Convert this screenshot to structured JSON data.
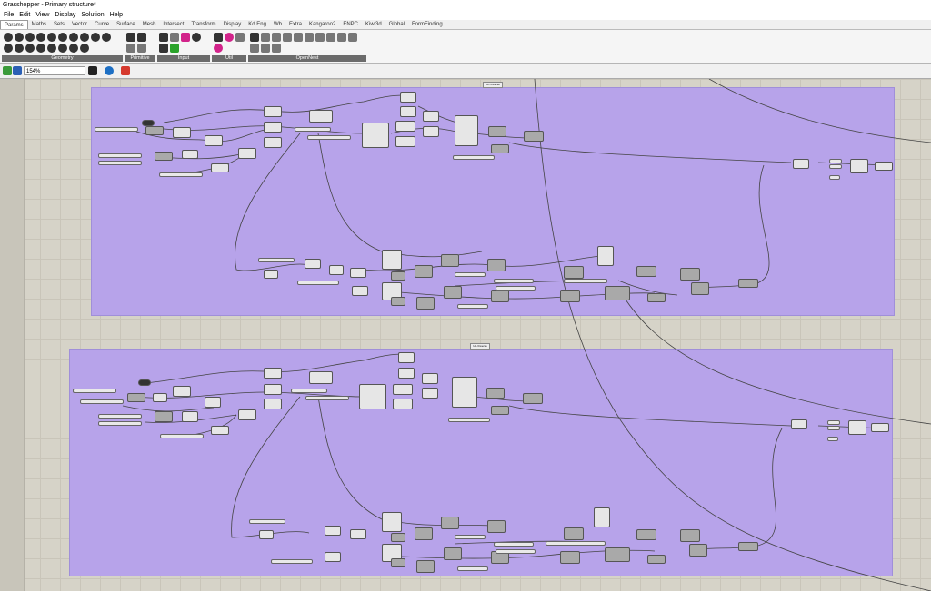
{
  "window": {
    "title": "Grasshopper - Primary structure*"
  },
  "menu": [
    "File",
    "Edit",
    "View",
    "Display",
    "Solution",
    "Help"
  ],
  "tabs": [
    "Params",
    "Maths",
    "Sets",
    "Vector",
    "Curve",
    "Surface",
    "Mesh",
    "Intersect",
    "Transform",
    "Display",
    "Kd Eng",
    "Wb",
    "Extra",
    "Kangaroo2",
    "ENPC",
    "Kiwi3d",
    "Global",
    "FormFinding"
  ],
  "active_tab": "Params",
  "ribbon_groups": [
    {
      "label": "Geometry"
    },
    {
      "label": "Primitive"
    },
    {
      "label": "Input"
    },
    {
      "label": "Util"
    },
    {
      "label": "OpenNest"
    }
  ],
  "toolbar": {
    "zoom": "154%"
  },
  "groups": [
    {
      "tag": "Un-/Inverse"
    },
    {
      "tag": "Un-/Inverse"
    }
  ],
  "colors": {
    "group_fill": "#b7a3ea",
    "canvas": "#d6d3c8",
    "component": "#a9a9a9",
    "wire": "#444444"
  }
}
